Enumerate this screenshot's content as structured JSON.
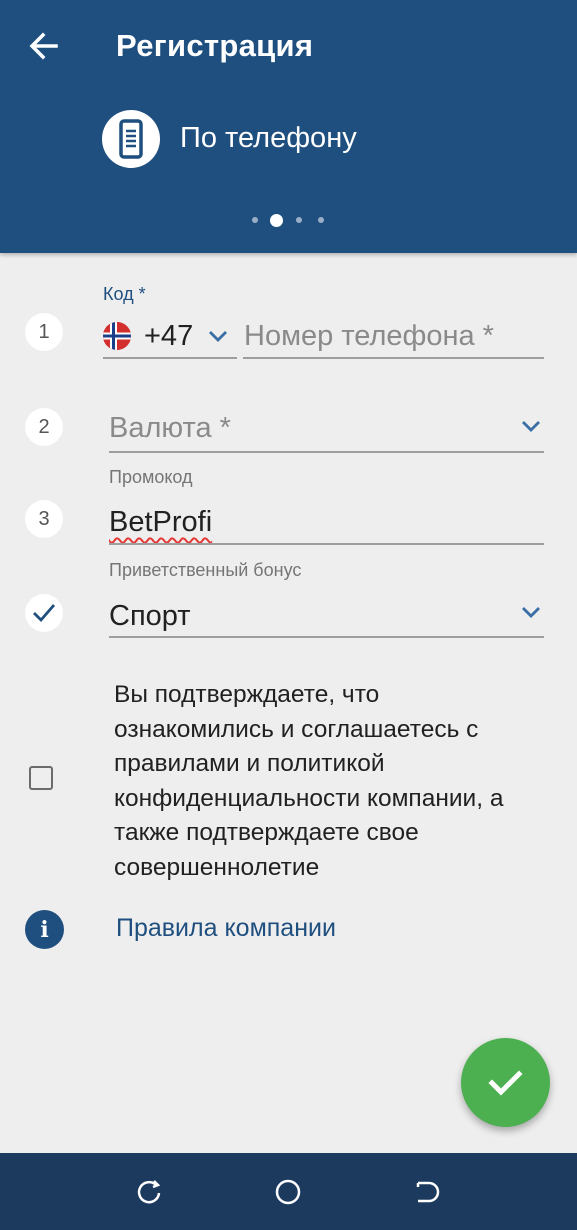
{
  "header": {
    "title": "Регистрация",
    "method_label": "По телефону",
    "pager": {
      "count": 4,
      "active_index": 1
    },
    "background_color": "#1f4f7f"
  },
  "form": {
    "code": {
      "label": "Код *",
      "value": "+47",
      "flag": "norway-flag",
      "step": "1"
    },
    "phone": {
      "placeholder": "Номер телефона *"
    },
    "currency": {
      "step": "2",
      "placeholder": "Валюта *"
    },
    "promo": {
      "step": "3",
      "label": "Промокод",
      "value": "BetProfi"
    },
    "bonus": {
      "step_icon": "check-icon",
      "label": "Приветственный бонус",
      "value": "Спорт"
    },
    "consent": {
      "checked": false,
      "text": "Вы подтверждаете, что ознакомились и соглашаетесь с правилами и политикой конфиденциальности компании, а также подтверждаете свое совершеннолетие"
    },
    "rules_link": "Правила компании"
  },
  "fab": {
    "icon": "check-icon",
    "color": "#4caf50"
  },
  "navbar": {
    "buttons": [
      "recent-apps-icon",
      "home-icon",
      "back-nav-icon"
    ],
    "background_color": "#1c3a5e"
  }
}
